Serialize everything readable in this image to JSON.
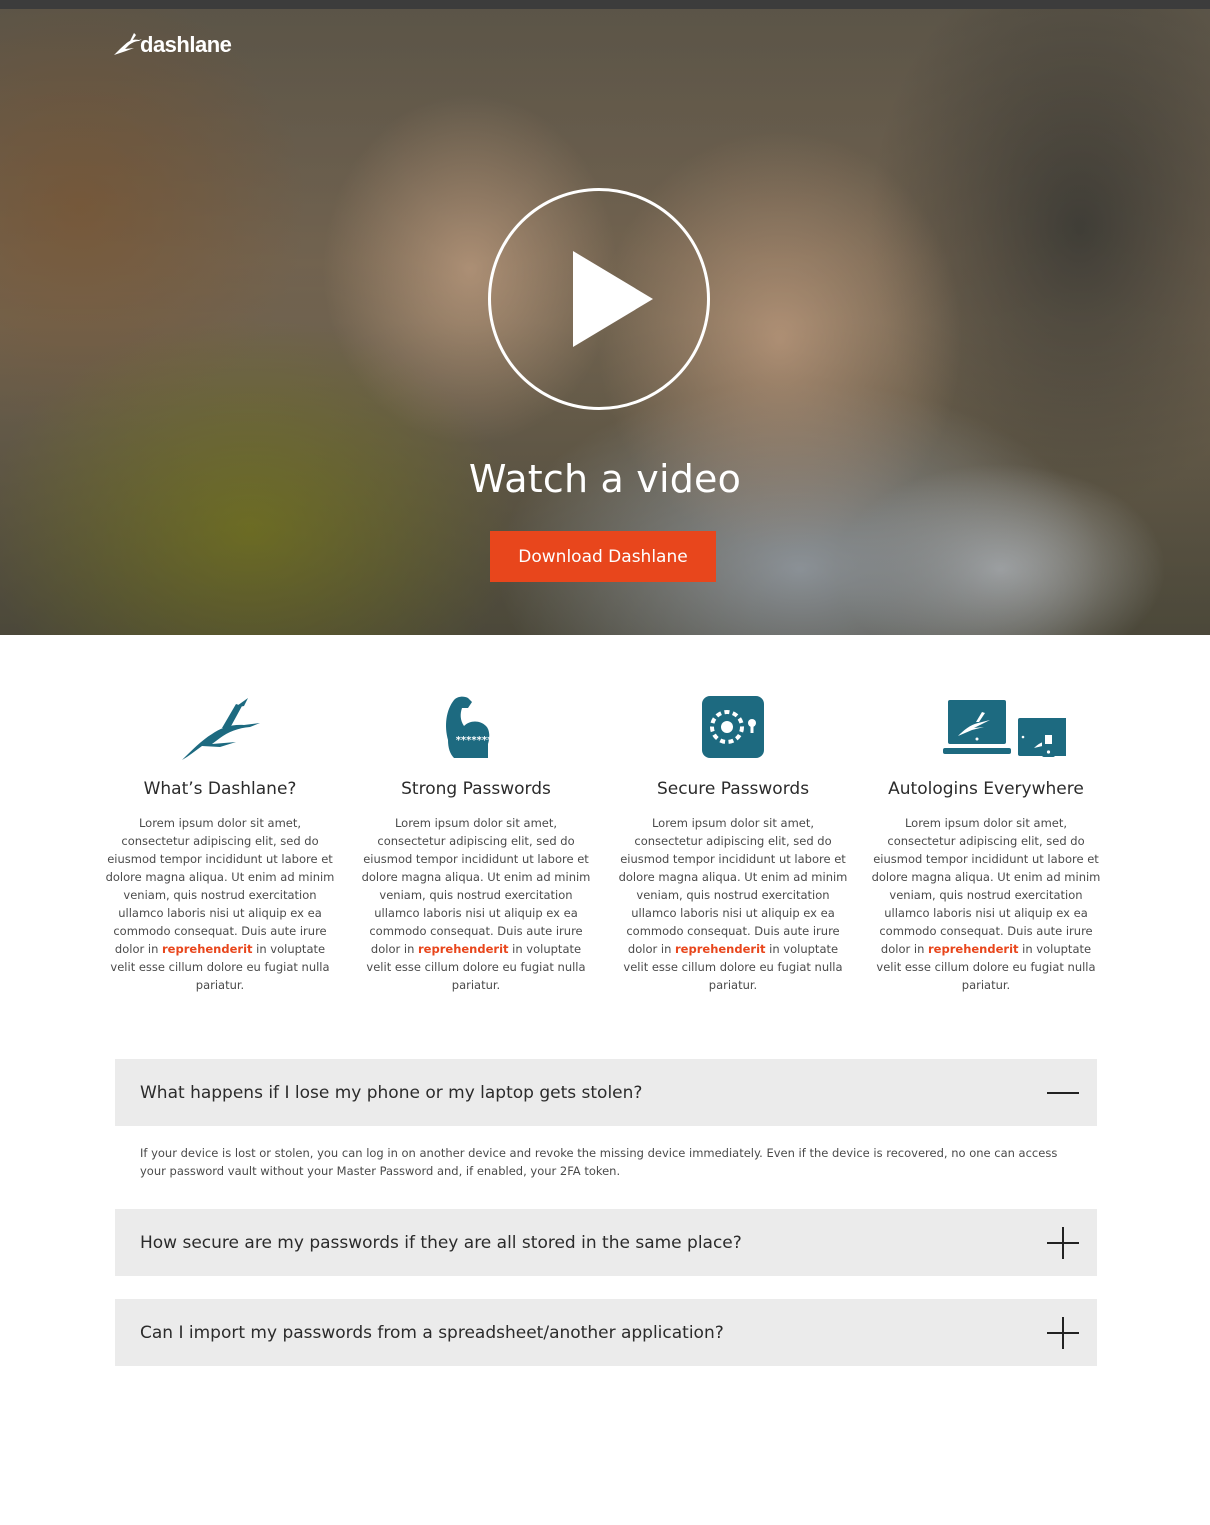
{
  "brand": {
    "name": "dashlane",
    "accent_color": "#e8461c",
    "icon_color": "#1d6a80"
  },
  "hero": {
    "play_icon": "play-icon",
    "title": "Watch a video",
    "cta_label": "Download Dashlane"
  },
  "features": [
    {
      "icon": "dashlane-impala-icon",
      "title": "What’s Dashlane?",
      "body_before": "Lorem ipsum dolor sit amet, consectetur adipiscing elit, sed do eiusmod tempor incididunt ut labore et dolore magna aliqua. Ut enim ad minim veniam, quis nostrud exercitation ullamco laboris nisi ut aliquip ex ea commodo consequat. Duis aute irure dolor in ",
      "body_link": "reprehenderit",
      "body_after": " in voluptate velit esse cillum dolore eu fugiat nulla pariatur."
    },
    {
      "icon": "flexed-arm-icon",
      "icon_text": "*******",
      "title": "Strong Passwords",
      "body_before": "Lorem ipsum dolor sit amet, consectetur adipiscing elit, sed do eiusmod tempor incididunt ut labore et dolore magna aliqua. Ut enim ad minim veniam, quis nostrud exercitation ullamco laboris nisi ut aliquip ex ea commodo consequat. Duis aute irure dolor in ",
      "body_link": "reprehenderit",
      "body_after": " in voluptate velit esse cillum dolore eu fugiat nulla pariatur."
    },
    {
      "icon": "vault-safe-icon",
      "title": "Secure Passwords",
      "body_before": "Lorem ipsum dolor sit amet, consectetur adipiscing elit, sed do eiusmod tempor incididunt ut labore et dolore magna aliqua. Ut enim ad minim veniam, quis nostrud exercitation ullamco laboris nisi ut aliquip ex ea commodo consequat. Duis aute irure dolor in ",
      "body_link": "reprehenderit",
      "body_after": " in voluptate velit esse cillum dolore eu fugiat nulla pariatur."
    },
    {
      "icon": "multi-device-icon",
      "title": "Autologins Everywhere",
      "body_before": "Lorem ipsum dolor sit amet, consectetur adipiscing elit, sed do eiusmod tempor incididunt ut labore et dolore magna aliqua. Ut enim ad minim veniam, quis nostrud exercitation ullamco laboris nisi ut aliquip ex ea commodo consequat. Duis aute irure dolor in ",
      "body_link": "reprehenderit",
      "body_after": " in voluptate velit esse cillum dolore eu fugiat nulla pariatur."
    }
  ],
  "faq": [
    {
      "question": "What happens if I lose my phone or my laptop gets stolen?",
      "expanded": true,
      "toggle_icon": "minus-icon",
      "answer": "If your device is lost or stolen, you can log in on another device and revoke the missing device immediately. Even if the device is recovered, no one can access your password vault without your Master Password and, if enabled, your 2FA token."
    },
    {
      "question": "How secure are my passwords if they are all stored in the same place?",
      "expanded": false,
      "toggle_icon": "plus-icon"
    },
    {
      "question": "Can I import my passwords from a spreadsheet/another application?",
      "expanded": false,
      "toggle_icon": "plus-icon"
    }
  ]
}
